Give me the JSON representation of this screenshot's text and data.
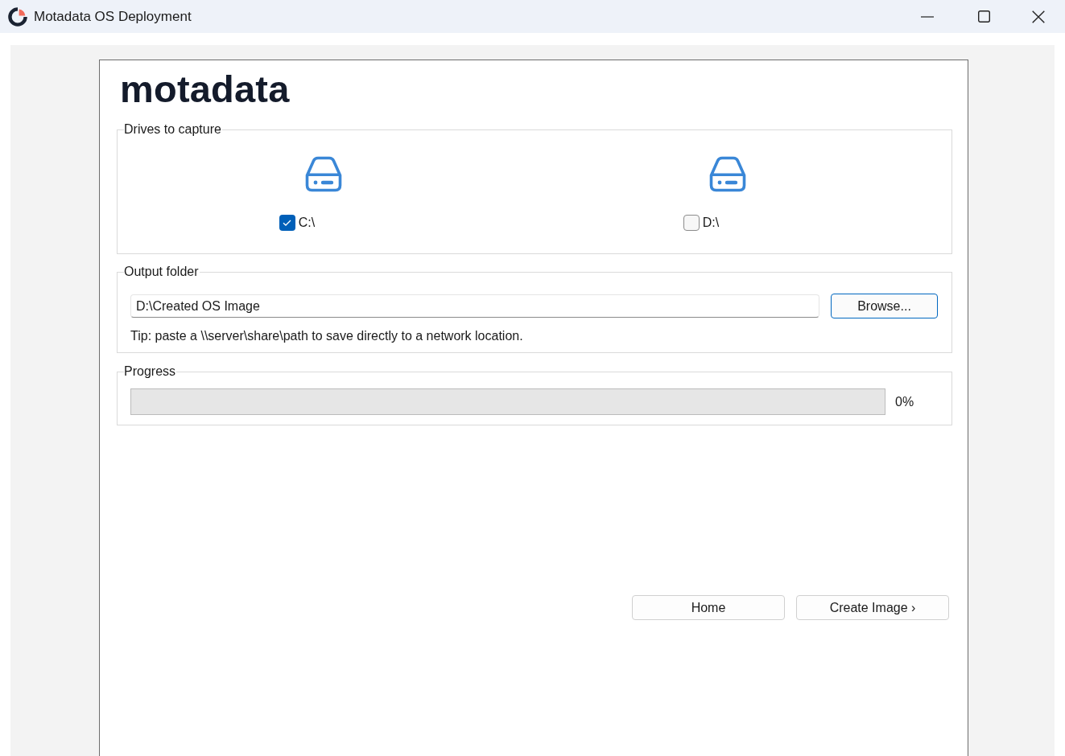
{
  "window": {
    "title": "Motadata OS Deployment"
  },
  "logo": {
    "text": "motadata"
  },
  "drives_group": {
    "title": "Drives to capture",
    "drives": [
      {
        "label": "C:\\",
        "checked": true
      },
      {
        "label": "D:\\",
        "checked": false
      }
    ]
  },
  "output_group": {
    "title": "Output folder",
    "path_field": {
      "value": "D:\\Created OS Image"
    },
    "browse_button": {
      "label": "Browse...",
      "focused": true
    },
    "tip": "Tip: paste a \\\\server\\share\\path to save directly to a network location."
  },
  "progress_group": {
    "title": "Progress",
    "level": 0,
    "reading": "0%"
  },
  "buttons": [
    {
      "label": "Home"
    },
    {
      "label": "Create Image ›"
    }
  ]
}
